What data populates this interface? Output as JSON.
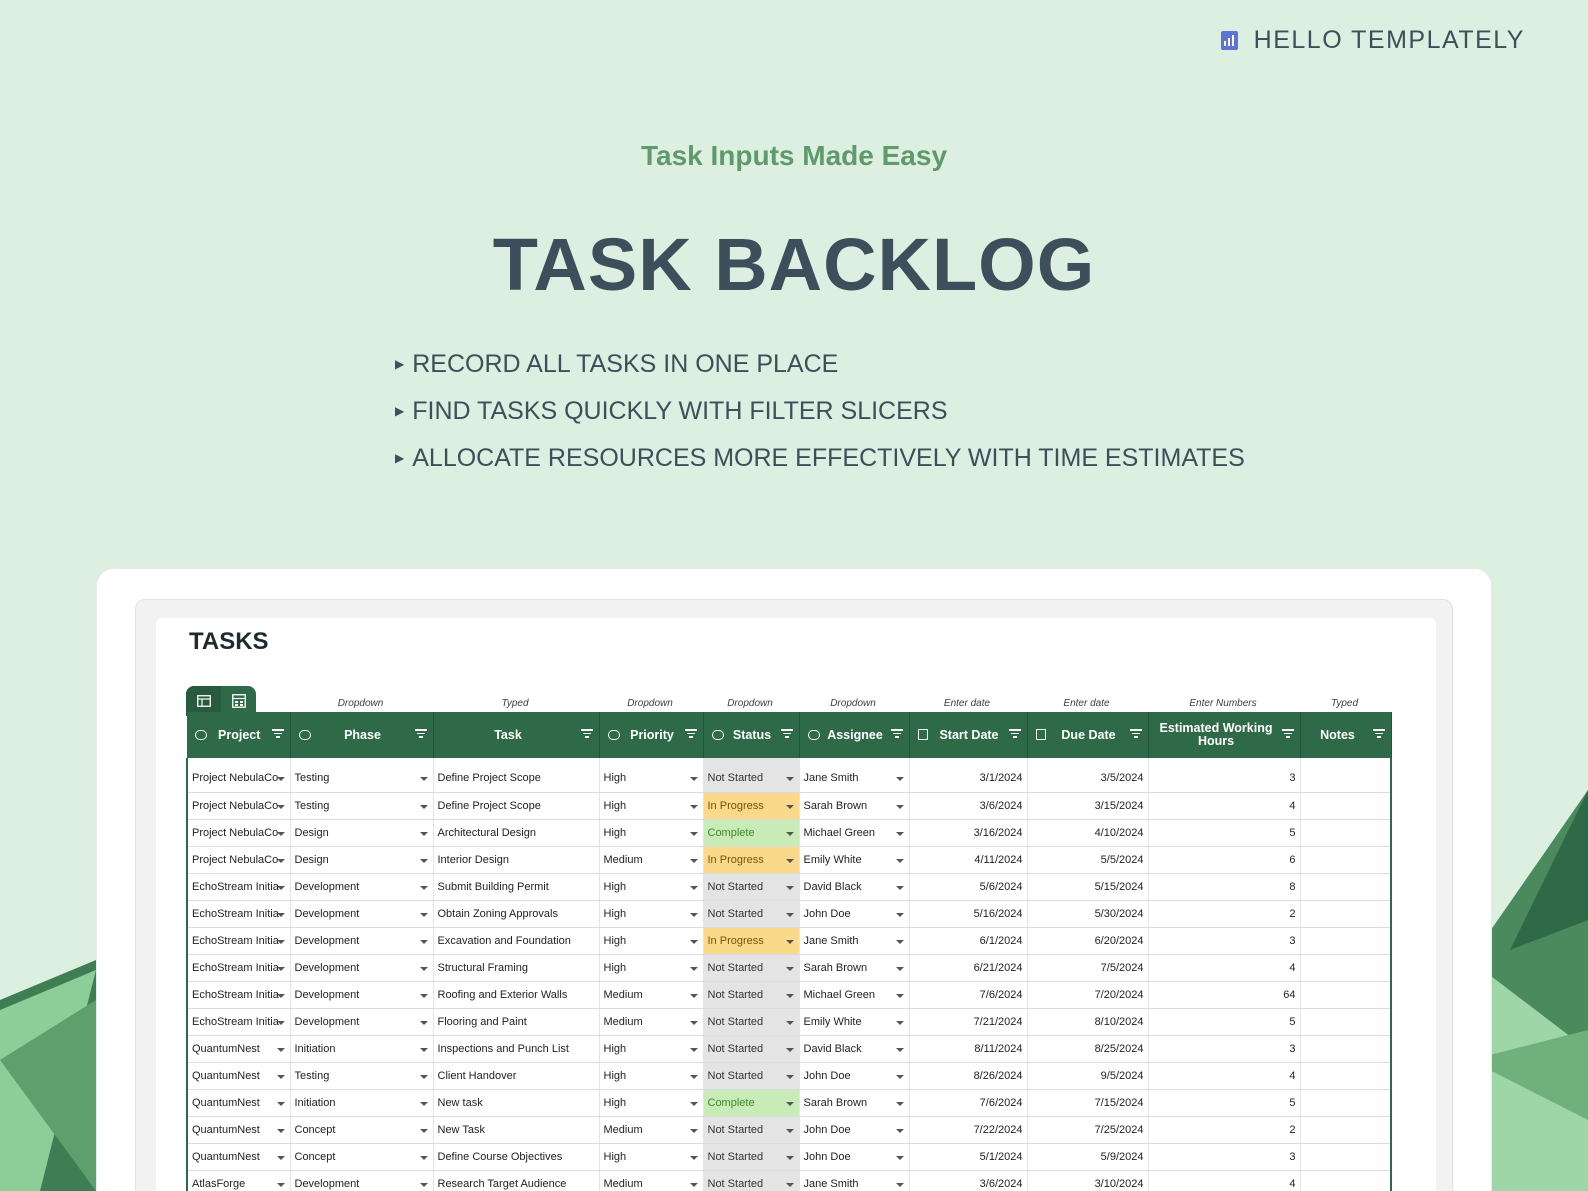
{
  "brand": {
    "name": "HELLO TEMPLATELY",
    "icon": "bar-chart-icon"
  },
  "hero": {
    "subtitle": "Task Inputs Made Easy",
    "title": "TASK BACKLOG",
    "bullets": [
      "RECORD ALL TASKS IN ONE PLACE",
      "FIND TASKS QUICKLY WITH FILTER SLICERS",
      "ALLOCATE RESOURCES MORE EFFECTIVELY WITH TIME ESTIMATES"
    ]
  },
  "sheet": {
    "title": "TASKS",
    "view_tabs": [
      "grid-view-icon",
      "card-view-icon"
    ],
    "hints": [
      "",
      "Dropdown",
      "Typed",
      "Dropdown",
      "Dropdown",
      "Dropdown",
      "Enter date",
      "Enter date",
      "Enter Numbers",
      "Typed"
    ],
    "headers": [
      "Project",
      "Phase",
      "Task",
      "Priority",
      "Status",
      "Assignee",
      "Start Date",
      "Due Date",
      "Estimated Working Hours",
      "Notes"
    ],
    "rows": [
      [
        "Project NebulaCo",
        "Testing",
        "Define Project Scope",
        "High",
        "Not Started",
        "Jane Smith",
        "3/1/2024",
        "3/5/2024",
        "3",
        ""
      ],
      [
        "Project NebulaCo",
        "Testing",
        "Define Project Scope",
        "High",
        "In Progress",
        "Sarah Brown",
        "3/6/2024",
        "3/15/2024",
        "4",
        ""
      ],
      [
        "Project NebulaCo",
        "Design",
        "Architectural Design",
        "High",
        "Complete",
        "Michael Green",
        "3/16/2024",
        "4/10/2024",
        "5",
        ""
      ],
      [
        "Project NebulaCo",
        "Design",
        "Interior Design",
        "Medium",
        "In Progress",
        "Emily White",
        "4/11/2024",
        "5/5/2024",
        "6",
        ""
      ],
      [
        "EchoStream Initia",
        "Development",
        "Submit Building Permit",
        "High",
        "Not Started",
        "David Black",
        "5/6/2024",
        "5/15/2024",
        "8",
        ""
      ],
      [
        "EchoStream Initia",
        "Development",
        "Obtain Zoning Approvals",
        "High",
        "Not Started",
        "John Doe",
        "5/16/2024",
        "5/30/2024",
        "2",
        ""
      ],
      [
        "EchoStream Initia",
        "Development",
        "Excavation and Foundation",
        "High",
        "In Progress",
        "Jane Smith",
        "6/1/2024",
        "6/20/2024",
        "3",
        ""
      ],
      [
        "EchoStream Initia",
        "Development",
        "Structural Framing",
        "High",
        "Not Started",
        "Sarah Brown",
        "6/21/2024",
        "7/5/2024",
        "4",
        ""
      ],
      [
        "EchoStream Initia",
        "Development",
        "Roofing and Exterior Walls",
        "Medium",
        "Not Started",
        "Michael Green",
        "7/6/2024",
        "7/20/2024",
        "64",
        ""
      ],
      [
        "EchoStream Initia",
        "Development",
        "Flooring and Paint",
        "Medium",
        "Not Started",
        "Emily White",
        "7/21/2024",
        "8/10/2024",
        "5",
        ""
      ],
      [
        "QuantumNest",
        "Initiation",
        "Inspections and Punch List",
        "High",
        "Not Started",
        "David Black",
        "8/11/2024",
        "8/25/2024",
        "3",
        ""
      ],
      [
        "QuantumNest",
        "Testing",
        "Client Handover",
        "High",
        "Not Started",
        "John Doe",
        "8/26/2024",
        "9/5/2024",
        "4",
        ""
      ],
      [
        "QuantumNest",
        "Initiation",
        "New task",
        "High",
        "Complete",
        "Sarah Brown",
        "7/6/2024",
        "7/15/2024",
        "5",
        ""
      ],
      [
        "QuantumNest",
        "Concept",
        "New Task",
        "Medium",
        "Not Started",
        "John Doe",
        "7/22/2024",
        "7/25/2024",
        "2",
        ""
      ],
      [
        "QuantumNest",
        "Concept",
        "Define Course Objectives",
        "High",
        "Not Started",
        "John Doe",
        "5/1/2024",
        "5/9/2024",
        "3",
        ""
      ],
      [
        "AtlasForge",
        "Development",
        "Research Target Audience",
        "Medium",
        "Not Started",
        "Jane Smith",
        "3/6/2024",
        "3/10/2024",
        "4",
        ""
      ]
    ]
  }
}
